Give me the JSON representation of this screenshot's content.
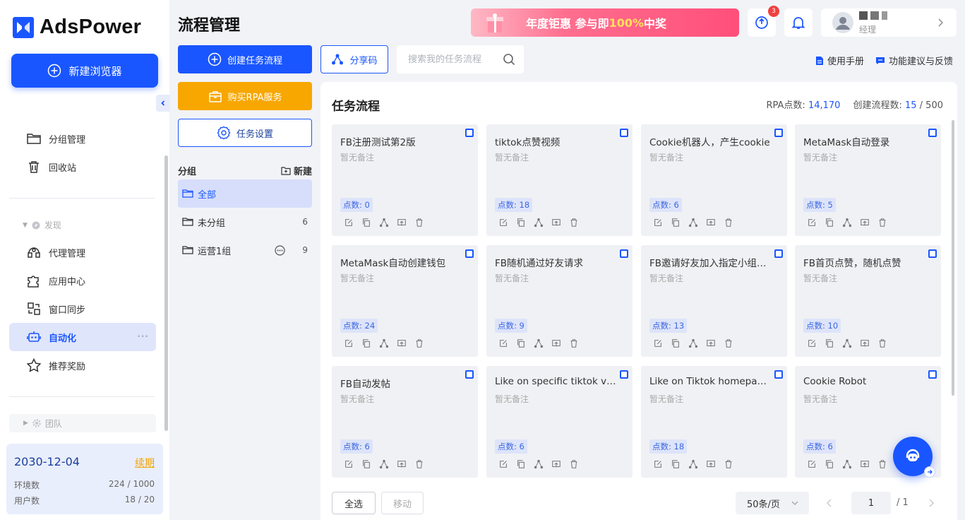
{
  "app": {
    "name": "AdsPower"
  },
  "sidebar": {
    "new_browser": "新建浏览器",
    "items_top": [
      {
        "label": "分组管理",
        "icon": "folder-icon"
      },
      {
        "label": "回收站",
        "icon": "trash-icon"
      }
    ],
    "discover_title": "发现",
    "items_discover": [
      {
        "label": "代理管理",
        "icon": "proxy-icon"
      },
      {
        "label": "应用中心",
        "icon": "puzzle-icon"
      },
      {
        "label": "窗口同步",
        "icon": "window-sync-icon"
      },
      {
        "label": "自动化",
        "icon": "robot-icon",
        "active": true
      },
      {
        "label": "推荐奖励",
        "icon": "star-icon"
      }
    ],
    "team_title": "团队",
    "account": {
      "date": "2030-12-04",
      "renew": "续期",
      "env_label": "环境数",
      "env_value": "224 / 1000",
      "user_label": "用户数",
      "user_value": "18 / 20"
    }
  },
  "header": {
    "title": "流程管理",
    "banner": {
      "text_a": "年度钜惠 参与即",
      "text_hl": "100%",
      "text_b": "中奖"
    },
    "notif_badge": "3",
    "user_role": "经理"
  },
  "toolbar": {
    "create_flow": "创建任务流程",
    "share_code": "分享码",
    "search_placeholder": "搜索我的任务流程",
    "manual": "使用手册",
    "feedback": "功能建议与反馈"
  },
  "left": {
    "buy_rpa": "购买RPA服务",
    "task_settings": "任务设置",
    "group_title": "分组",
    "group_new": "新建",
    "groups": [
      {
        "label": "全部",
        "count": "",
        "active": true
      },
      {
        "label": "未分组",
        "count": "6"
      },
      {
        "label": "运营1组",
        "count": "9"
      }
    ]
  },
  "panel": {
    "title": "任务流程",
    "rpa_points_label": "RPA点数:",
    "rpa_points_value": "14,170",
    "flow_count_label": "创建流程数:",
    "flow_count_value": "15",
    "flow_count_max": "/ 500",
    "note_default": "暂无备注",
    "cards": [
      {
        "title": "FB注册测试第2版",
        "note": "暂无备注",
        "points": "点数: 0"
      },
      {
        "title": "tiktok点赞视频",
        "note": "暂无备注",
        "points": "点数: 18"
      },
      {
        "title": "Cookie机器人，产生cookie",
        "note": "暂无备注",
        "points": "点数: 6"
      },
      {
        "title": "MetaMask自动登录",
        "note": "暂无备注",
        "points": "点数: 5"
      },
      {
        "title": "MetaMask自动创建钱包",
        "note": "暂无备注",
        "points": "点数: 24"
      },
      {
        "title": "FB随机通过好友请求",
        "note": "暂无备注",
        "points": "点数: 9"
      },
      {
        "title": "FB邀请好友加入指定小组（…",
        "note": "暂无备注",
        "points": "点数: 13"
      },
      {
        "title": "FB首页点赞，随机点赞",
        "note": "暂无备注",
        "points": "点数: 10"
      },
      {
        "title": "FB自动发帖",
        "note": "暂无备注",
        "points": "点数: 6"
      },
      {
        "title": "Like on specific tiktok vid…",
        "note": "暂无备注",
        "points": "点数: 6"
      },
      {
        "title": "Like on Tiktok homepage…",
        "note": "暂无备注",
        "points": "点数: 18"
      },
      {
        "title": "Cookie Robot",
        "note": "暂无备注",
        "points": "点数: 6"
      }
    ],
    "select_all": "全选",
    "move": "移动",
    "page_size": "50条/页",
    "page_current": "1",
    "page_total": "/ 1"
  }
}
